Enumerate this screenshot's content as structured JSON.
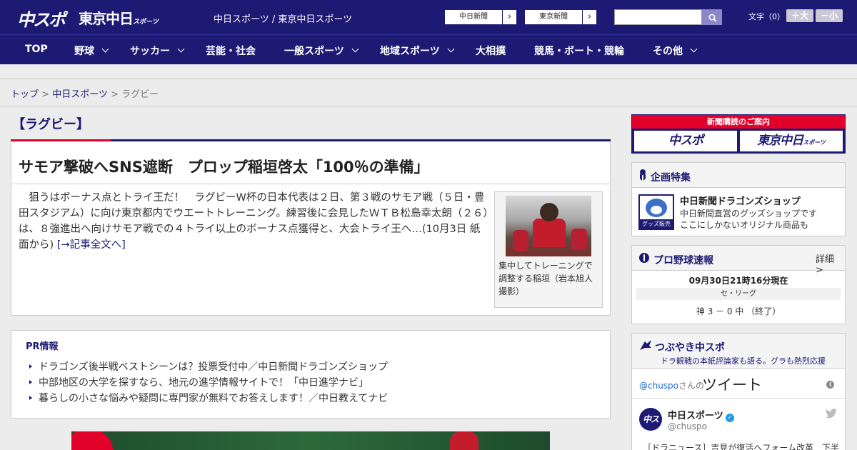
{
  "header": {
    "logo_primary": "中スポ",
    "logo_secondary": "東京中日",
    "logo_secondary_small": "スポーツ",
    "site_title": "中日スポーツ / 東京中日スポーツ",
    "ext_links": [
      {
        "label": "中日新聞",
        "arrow": "›"
      },
      {
        "label": "東京新聞",
        "arrow": "›"
      }
    ],
    "search": {
      "value": "",
      "placeholder": ""
    },
    "font_size": {
      "label": "文字（0）",
      "increase": "＋大",
      "decrease": "－小"
    },
    "colors": {
      "brand": "#1d1a74",
      "accent": "#e0002a"
    }
  },
  "nav": {
    "items": [
      {
        "label": "TOP",
        "has_dropdown": false
      },
      {
        "label": "野球",
        "has_dropdown": true
      },
      {
        "label": "サッカー",
        "has_dropdown": true
      },
      {
        "label": "芸能・社会",
        "has_dropdown": false
      },
      {
        "label": "一般スポーツ",
        "has_dropdown": true
      },
      {
        "label": "地域スポーツ",
        "has_dropdown": true
      },
      {
        "label": "大相撲",
        "has_dropdown": false
      },
      {
        "label": "競馬・ボート・競輪",
        "has_dropdown": false
      },
      {
        "label": "その他",
        "has_dropdown": true
      }
    ]
  },
  "breadcrumb": {
    "home": "トップ",
    "sep1": " > ",
    "section": "中日スポーツ",
    "sep2": " > ",
    "current": "ラグビー"
  },
  "category": {
    "label": "【ラグビー】"
  },
  "article": {
    "title": "サモア撃破へSNS遮断　プロップ稲垣啓太「100％の準備」",
    "lead": "　狙うはボーナス点とトライ王だ！　ラグビーW杯の日本代表は２日、第３戦のサモア戦（５日・豊田スタジアム）に向け東京都内でウエートトレーニング。練習後に会見したＷＴＢ松島幸太朗（２６）は、８強進出へ向けサモア戦での４トライ以上のボーナス点獲得と、大会トライ王へ…(10月3日 紙面から)",
    "more_link": "[→記事全文へ]",
    "photo_caption": "集中してトレーニングで調整する稲垣（岩本旭人撮影）"
  },
  "pr": {
    "title": "PR情報",
    "items": [
      "ドラゴンズ後半戦ベストシーンは？投票受付中／中日新聞ドラゴンズショップ",
      "中部地区の大学を探すなら、地元の進学情報サイトで！「中日進学ナビ」",
      "暮らしの小さな悩みや疑問に専門家が無料でお答えします！／中日教えてナビ"
    ]
  },
  "sidebar": {
    "subscription": {
      "heading": "新聞購読のご案内",
      "btn1": "中スポ",
      "btn2": "東京中日",
      "btn2_small": "スポーツ"
    },
    "feature": {
      "title": "企画特集",
      "shop_name": "中日新聞ドラゴンズショップ",
      "shop_desc1": "中日新聞直営のグッズショップです",
      "shop_desc2": "ここにしかないオリジナル商品も",
      "shop_tag": "グッズ販売中"
    },
    "baseball": {
      "title": "プロ野球速報",
      "more": "詳細 >",
      "time": "09月30日21時16分現在",
      "league": "セ・リーグ",
      "score": "神 3 － 0 中 （終了）"
    },
    "twitter": {
      "title": "つぶやき中スポ",
      "subtitle": "ドラ観戦の本紙評論家も語る。グラも熱烈応援",
      "handle": "@chuspo",
      "handle_suffix": "さんの",
      "tweets_word": "ツイート",
      "info": "i",
      "avatar_text": "中スポ",
      "account_name": "中日スポーツ",
      "verified": "✓",
      "account_user": "@chuspo",
      "tweet_text": "［ドラニュース］吉見が復活へフォーム改革　下半"
    }
  }
}
